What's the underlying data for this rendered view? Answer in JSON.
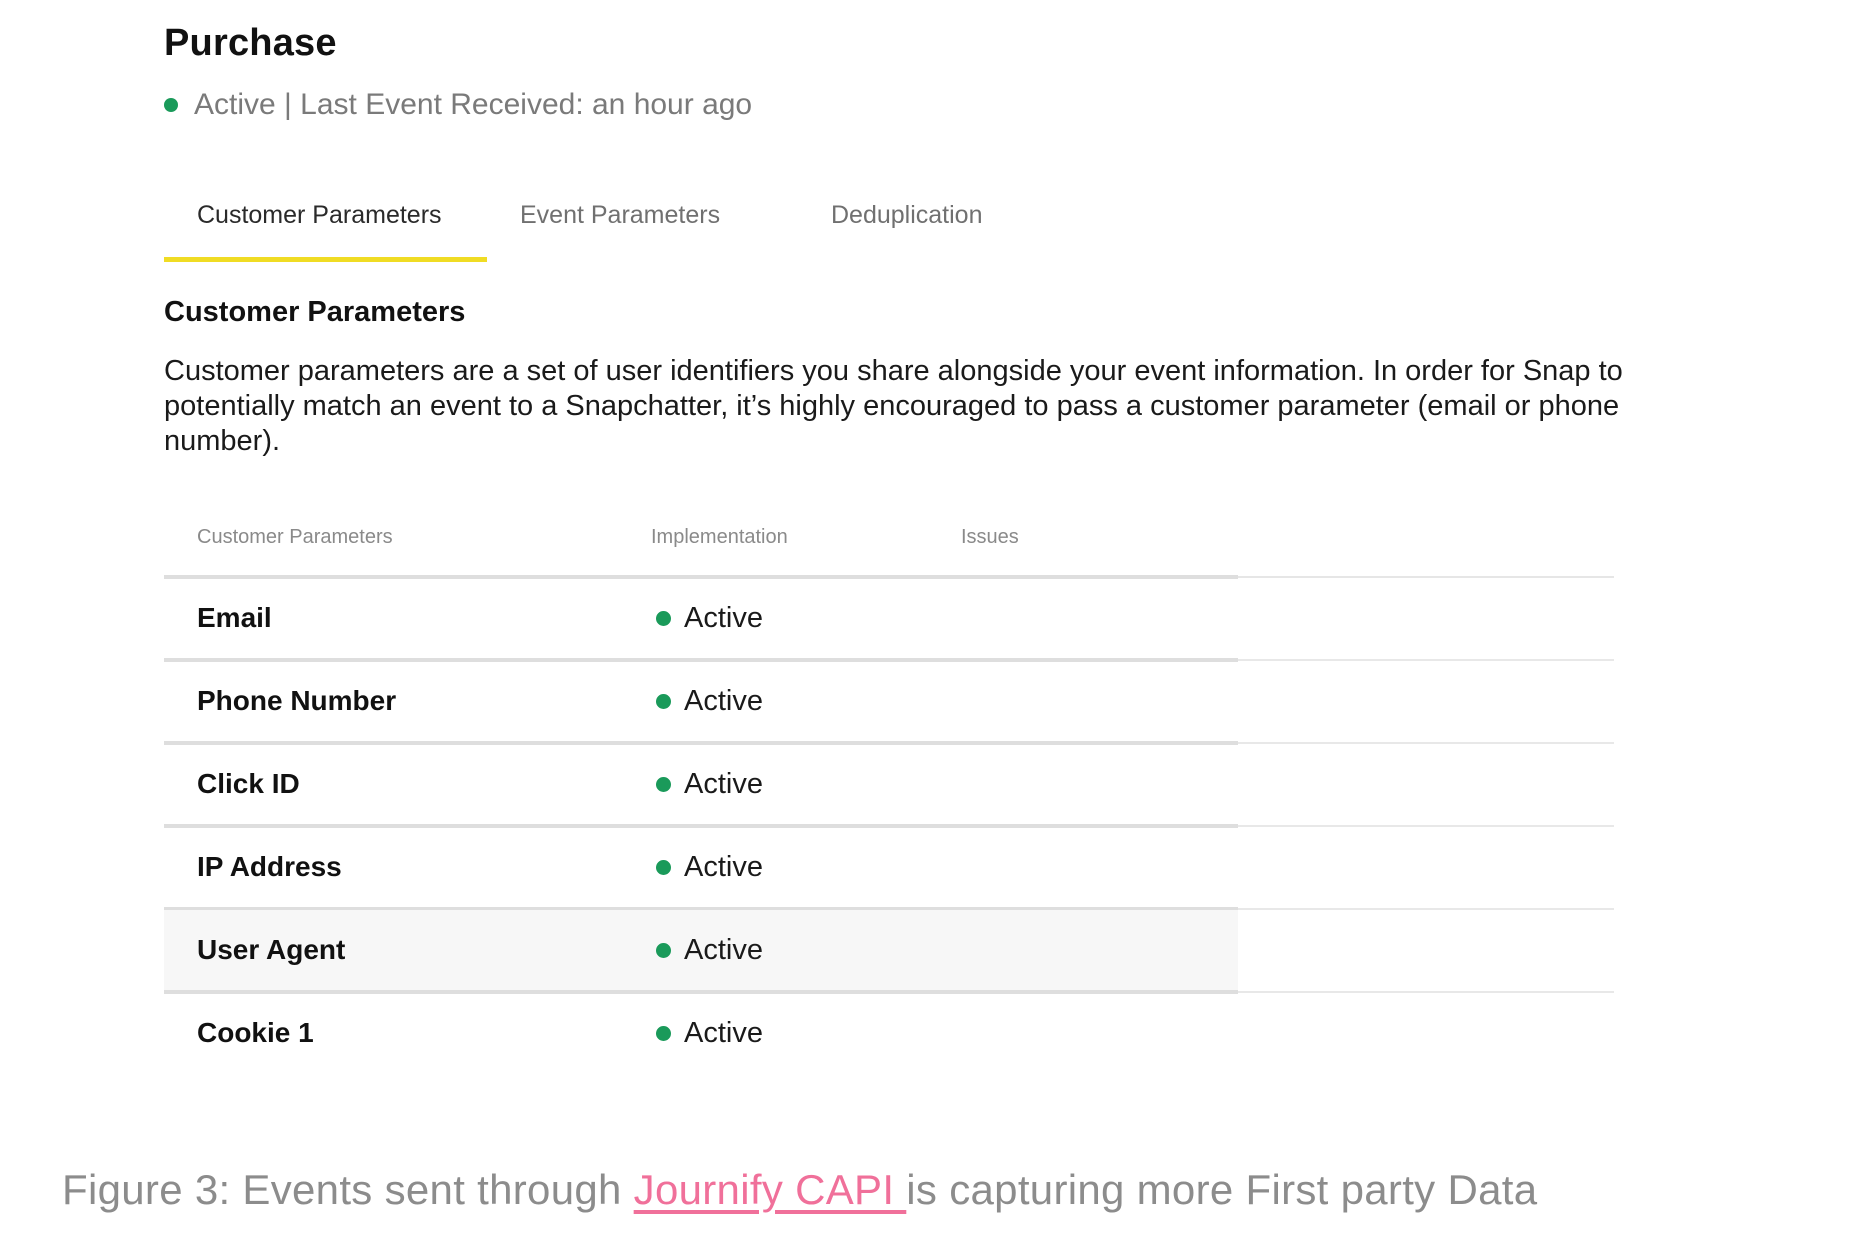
{
  "event": {
    "title": "Purchase",
    "status_text": "Active | Last Event Received: an hour ago",
    "status_color": "#1a9a5a"
  },
  "tabs": [
    {
      "label": "Customer Parameters",
      "active": true
    },
    {
      "label": "Event Parameters",
      "active": false
    },
    {
      "label": "Deduplication",
      "active": false
    }
  ],
  "active_tab_underline_color": "#f0dc24",
  "section": {
    "title": "Customer Parameters",
    "description": "Customer parameters are a set of user identifiers you share alongside your event information. In order for Snap to potentially match an event to a Snapchatter, it’s highly encouraged to pass a customer parameter (email or phone number)."
  },
  "table": {
    "columns": [
      "Customer Parameters",
      "Implementation",
      "Issues"
    ],
    "rows": [
      {
        "parameter": "Email",
        "implementation": "Active",
        "issues": ""
      },
      {
        "parameter": "Phone Number",
        "implementation": "Active",
        "issues": ""
      },
      {
        "parameter": "Click ID",
        "implementation": "Active",
        "issues": ""
      },
      {
        "parameter": "IP Address",
        "implementation": "Active",
        "issues": ""
      },
      {
        "parameter": "User Agent",
        "implementation": "Active",
        "issues": ""
      },
      {
        "parameter": "Cookie 1",
        "implementation": "Active",
        "issues": ""
      }
    ]
  },
  "caption": {
    "prefix": "Figure 3:  Events sent through ",
    "link_text": "Journify CAPI ",
    "suffix": "is capturing more First party Data",
    "link_color": "#f0709a"
  }
}
